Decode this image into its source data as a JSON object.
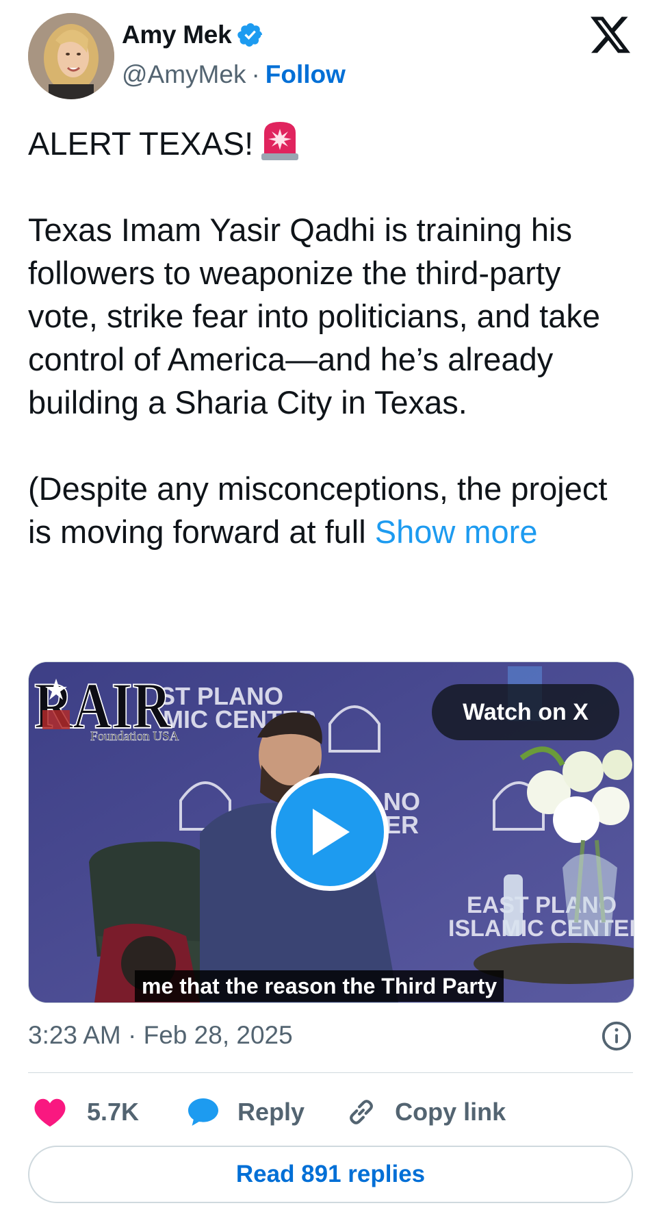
{
  "author": {
    "display_name": "Amy Mek",
    "handle": "@AmyMek",
    "separator": "·",
    "follow_label": "Follow",
    "verified": true,
    "avatar_icon": "profile-photo"
  },
  "brand": {
    "logo_icon": "x-logo-icon"
  },
  "tweet": {
    "line1": "ALERT TEXAS!",
    "siren_icon": "rotating-light-emoji",
    "body": "Texas Imam Yasir Qadhi is training his followers to weaponize the third-party vote, strike fear into politicians, and take control of America—and he’s already building a Sharia City in Texas.",
    "body2": "(Despite any misconceptions, the project is moving forward at full ",
    "show_more_label": "Show more"
  },
  "media": {
    "watermark": "RAIR",
    "watermark_sub": "Foundation USA",
    "watch_label": "Watch on X",
    "caption": "me that the reason the Third Party",
    "play_icon": "play-icon"
  },
  "meta": {
    "timestamp": "3:23 AM · Feb 28, 2025",
    "info_icon": "info-icon"
  },
  "actions": {
    "like_count": "5.7K",
    "reply_label": "Reply",
    "copy_link_label": "Copy link",
    "read_replies_label": "Read 891 replies"
  },
  "colors": {
    "link": "#1d9bf0",
    "follow": "#006fd6",
    "like": "#f91880",
    "secondary_text": "#536471",
    "border": "#cfd9de"
  }
}
